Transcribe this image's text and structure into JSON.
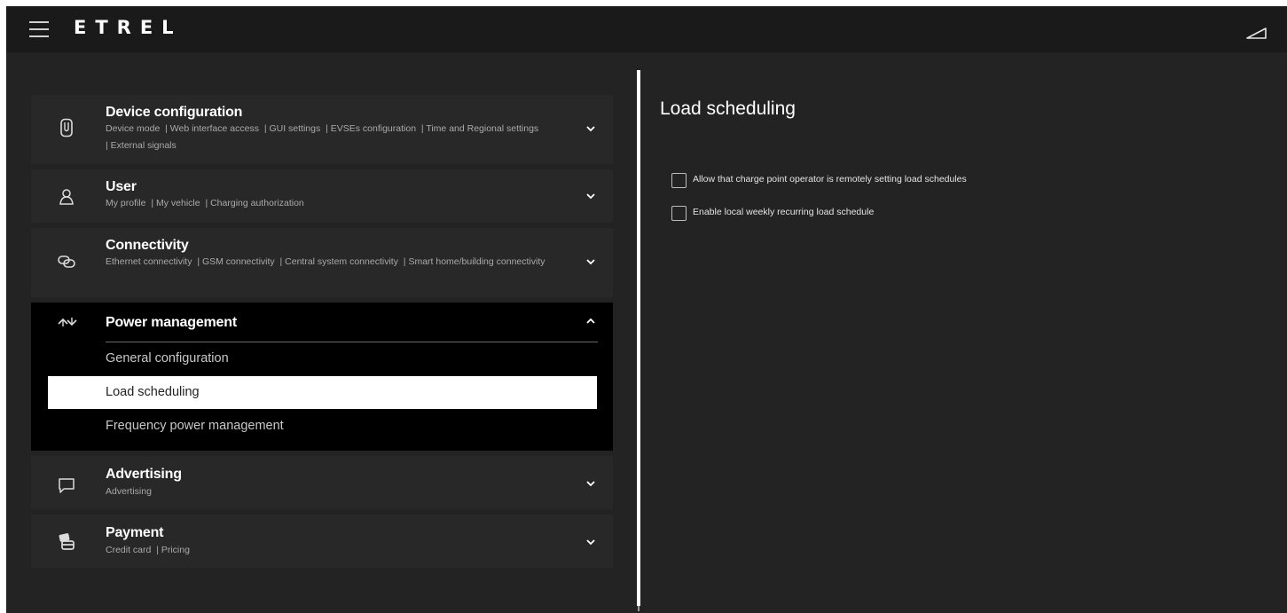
{
  "header": {
    "logo": "ETRΕL",
    "menu_icon": "hamburger-menu-icon",
    "corner_icon": "signal-strength-icon"
  },
  "menu": {
    "sections": [
      {
        "title": "Device configuration",
        "icon": "device-icon",
        "links": [
          "Device mode",
          "| Web interface access",
          "| GUI settings",
          "| EVSEs configuration",
          "| Time and Regional settings",
          "| External signals"
        ],
        "expanded": false
      },
      {
        "title": "User",
        "icon": "user-icon",
        "links": [
          "My profile",
          "| My vehicle",
          "| Charging authorization"
        ],
        "expanded": false
      },
      {
        "title": "Connectivity",
        "icon": "link-icon",
        "links": [
          "Ethernet connectivity",
          "| GSM connectivity",
          "| Central system connectivity",
          "| Smart home/building connectivity"
        ],
        "expanded": false
      },
      {
        "title": "Power management",
        "icon": "power-flow-icon",
        "expanded": true,
        "items": [
          {
            "label": "General configuration",
            "active": false
          },
          {
            "label": "Load scheduling",
            "active": true
          },
          {
            "label": "Frequency power management",
            "active": false
          }
        ]
      },
      {
        "title": "Advertising",
        "icon": "chat-bubble-icon",
        "links": [
          "Advertising"
        ],
        "expanded": false
      },
      {
        "title": "Payment",
        "icon": "credit-card-icon",
        "links": [
          "Credit card",
          "| Pricing"
        ],
        "expanded": false
      }
    ]
  },
  "content": {
    "title": "Load scheduling",
    "options": [
      {
        "label": "Allow that charge point operator is remotely setting load schedules",
        "checked": false
      },
      {
        "label": "Enable local weekly recurring load schedule",
        "checked": false
      }
    ]
  },
  "colors": {
    "background": "#232323",
    "topbar": "#1a1a1a",
    "section": "#282828",
    "expanded_section": "#000000",
    "active_item": "#ffffff"
  }
}
